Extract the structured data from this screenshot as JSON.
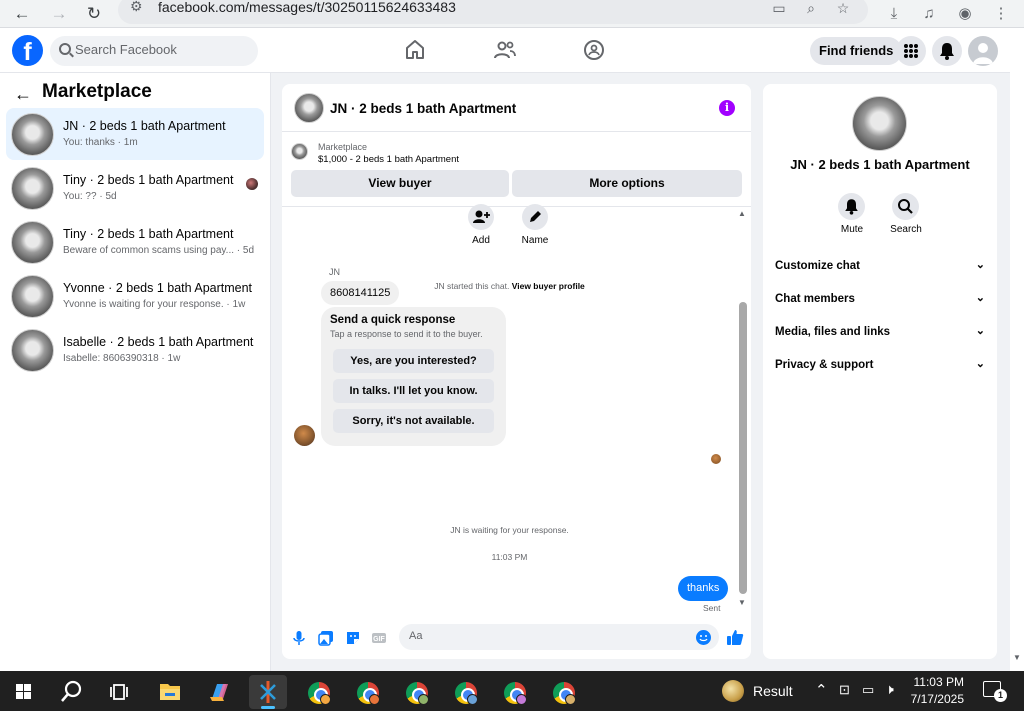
{
  "browser": {
    "url": "facebook.com/messages/t/30250115624633483"
  },
  "header": {
    "logo": "f",
    "search_placeholder": "Search Facebook",
    "find_friends": "Find friends"
  },
  "sidebar": {
    "title": "Marketplace",
    "conversations": [
      {
        "title": "JN · 2 beds 1 bath Apartment",
        "subtitle": "You: thanks · 1m"
      },
      {
        "title": "Tiny · 2 beds 1 bath Apartment",
        "subtitle": "You: ?? · 5d"
      },
      {
        "title": "Tiny · 2 beds 1 bath Apartment",
        "subtitle": "Beware of common scams using pay...  · 5d"
      },
      {
        "title": "Yvonne · 2 beds 1 bath Apartment",
        "subtitle": "Yvonne is waiting for your response. · 1w"
      },
      {
        "title": "Isabelle · 2 beds 1 bath Apartment",
        "subtitle": "Isabelle: 8606390318 · 1w"
      }
    ]
  },
  "chat": {
    "title": "JN · 2 beds 1 bath Apartment",
    "listing_label": "Marketplace",
    "listing_detail": "$1,000 - 2 beds 1 bath Apartment",
    "view_buyer": "View buyer",
    "more_options": "More options",
    "actions": {
      "add": "Add",
      "name": "Name"
    },
    "started_text": "JN started this chat.",
    "view_buyer_profile": "View buyer profile",
    "sender_name": "JN",
    "phone_message": "8608141125",
    "quick_response_title": "Send a quick response",
    "quick_response_subtitle": "Tap a response to send it to the buyer.",
    "quick_responses": [
      "Yes, are you interested?",
      "In talks. I'll let you know.",
      "Sorry, it's not available."
    ],
    "waiting_text": "JN is waiting for your response.",
    "timestamp": "11:03 PM",
    "outgoing_message": "thanks",
    "sent_label": "Sent",
    "composer_placeholder": "Aa"
  },
  "info_panel": {
    "title": "JN · 2 beds 1 bath Apartment",
    "mute": "Mute",
    "search": "Search",
    "rows": [
      "Customize chat",
      "Chat members",
      "Media, files and links",
      "Privacy & support"
    ]
  },
  "taskbar": {
    "result_label": "Result",
    "time": "11:03 PM",
    "date": "7/17/2025",
    "notification_count": "1"
  },
  "colors": {
    "fb_blue": "#0866ff",
    "messenger_blue": "#0a7cff",
    "info_purple": "#a100ff",
    "active_row": "#e7f3ff"
  }
}
